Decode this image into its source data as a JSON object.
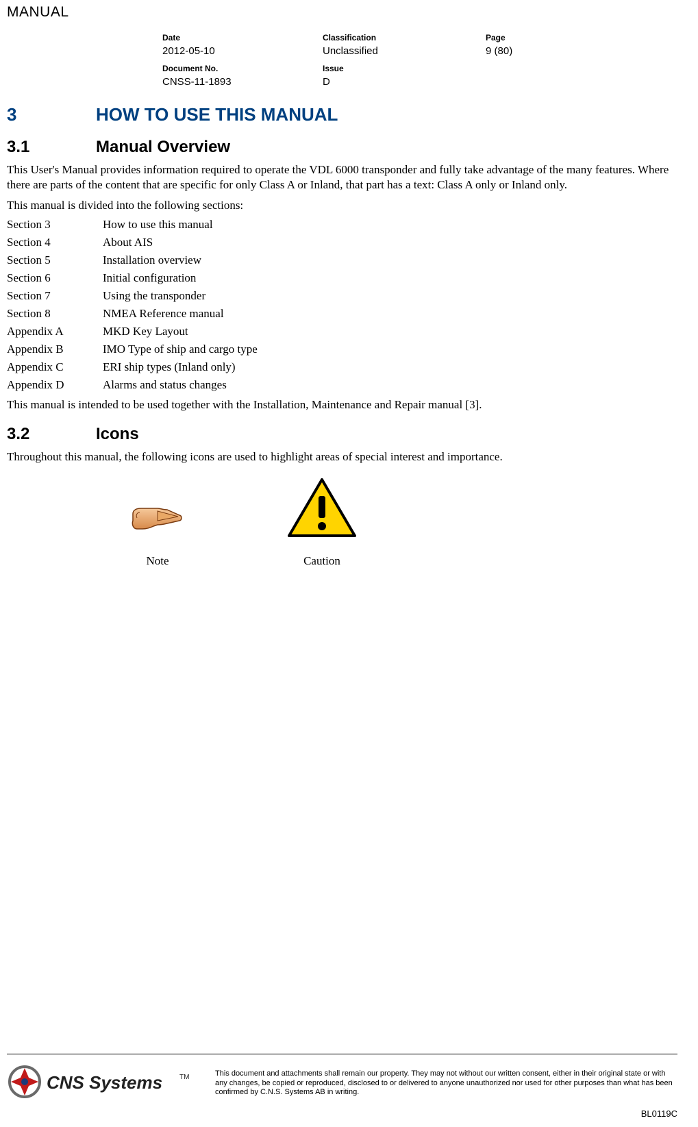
{
  "doc_type": "MANUAL",
  "header": {
    "date_label": "Date",
    "date": "2012-05-10",
    "classification_label": "Classification",
    "classification": "Unclassified",
    "page_label": "Page",
    "page": "9 (80)",
    "docno_label": "Document No.",
    "docno": "CNSS-11-1893",
    "issue_label": "Issue",
    "issue": "D"
  },
  "section3": {
    "num": "3",
    "title": "HOW TO USE THIS MANUAL"
  },
  "section31": {
    "num": "3.1",
    "title": "Manual Overview",
    "para1": "This User's Manual provides information required to operate the VDL 6000 transponder and fully take advantage of the many features. Where there are parts of the content that are specific for only Class A or Inland, that part has a text: Class A only or Inland only.",
    "para2": "This manual is divided into the following sections:",
    "toc": [
      {
        "sec": "Section 3",
        "desc": "How to use this manual"
      },
      {
        "sec": "Section 4",
        "desc": "About AIS"
      },
      {
        "sec": "Section 5",
        "desc": "Installation overview"
      },
      {
        "sec": "Section 6",
        "desc": "Initial configuration"
      },
      {
        "sec": "Section 7",
        "desc": "Using the transponder"
      },
      {
        "sec": "Section 8",
        "desc": "NMEA Reference manual"
      },
      {
        "sec": "Appendix A",
        "desc": "MKD Key Layout"
      },
      {
        "sec": "Appendix B",
        "desc": "IMO Type of ship and cargo type"
      },
      {
        "sec": "Appendix C",
        "desc": "ERI ship types (Inland only)"
      },
      {
        "sec": "Appendix D",
        "desc": "Alarms and status changes"
      }
    ],
    "para3": "This manual is intended to be used together with the Installation, Maintenance and Repair manual [3]."
  },
  "section32": {
    "num": "3.2",
    "title": "Icons",
    "para1": "Throughout this manual, the following icons are used to highlight areas of special interest and importance.",
    "note_label": "Note",
    "caution_label": "Caution"
  },
  "footer": {
    "company": "CNS Systems™",
    "disclaimer": "This document and attachments shall remain our property. They may not without our written consent, either in their original state or with any changes, be copied or reproduced, disclosed to or delivered to anyone unauthorized nor used for other purposes than what has been confirmed by C.N.S. Systems AB in writing.",
    "code": "BL0119C"
  }
}
